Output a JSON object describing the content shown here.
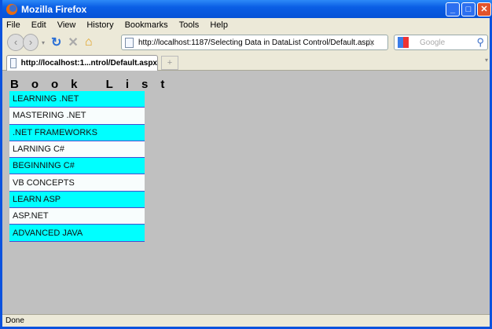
{
  "window": {
    "title": "Mozilla Firefox"
  },
  "menu": [
    "File",
    "Edit",
    "View",
    "History",
    "Bookmarks",
    "Tools",
    "Help"
  ],
  "address": {
    "url": "http://localhost:1187/Selecting Data in DataList Control/Default.aspx"
  },
  "search": {
    "placeholder": "Google"
  },
  "tab": {
    "label": "http://localhost:1...ntrol/Default.aspx",
    "new_tab": "+"
  },
  "page": {
    "heading": "Book List",
    "books": [
      "LEARNING .NET",
      "MASTERING .NET",
      ".NET FRAMEWORKS",
      "LARNING C#",
      "BEGINNING C#",
      "VB CONCEPTS",
      "LEARN ASP",
      "ASP.NET",
      "ADVANCED JAVA"
    ]
  },
  "status": "Done",
  "colors": {
    "alt_row": "#00ffff",
    "row": "#f8fdfd",
    "page_bg": "#c0c0c0"
  }
}
